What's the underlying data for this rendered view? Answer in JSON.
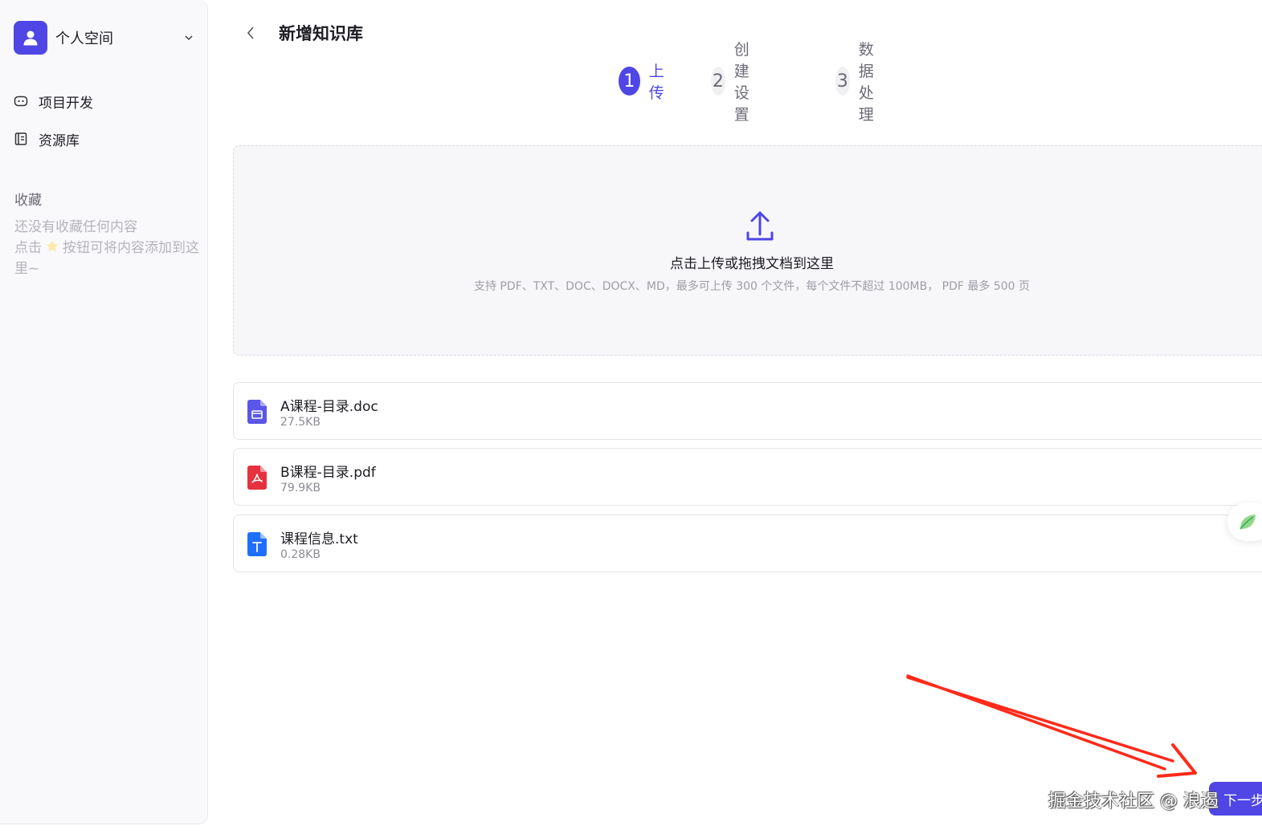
{
  "sidebar": {
    "workspace_name": "个人空间",
    "nav": [
      {
        "label": "项目开发",
        "icon": "bot-icon"
      },
      {
        "label": "资源库",
        "icon": "library-icon"
      }
    ],
    "favorites_title": "收藏",
    "favorites_empty_line1": "还没有收藏任何内容",
    "favorites_empty_line2_prefix": "点击",
    "favorites_empty_line2_suffix": "按钮可将内容添加到这里~"
  },
  "header": {
    "title": "新增知识库"
  },
  "steps": [
    {
      "num": "1",
      "label": "上传",
      "state": "active"
    },
    {
      "num": "2",
      "label": "创建设置",
      "state": "inactive"
    },
    {
      "num": "3",
      "label": "数据处理",
      "state": "inactive"
    }
  ],
  "upload": {
    "title": "点击上传或拖拽文档到这里",
    "hint": "支持 PDF、TXT、DOC、DOCX、MD，最多可上传 300 个文件，每个文件不超过 100MB， PDF 最多 500 页"
  },
  "files": [
    {
      "name": "A课程-目录.doc",
      "size": "27.5KB",
      "type": "doc"
    },
    {
      "name": "B课程-目录.pdf",
      "size": "79.9KB",
      "type": "pdf"
    },
    {
      "name": "课程信息.txt",
      "size": "0.28KB",
      "type": "txt"
    }
  ],
  "footer": {
    "next_label": "下一步",
    "watermark": "掘金技术社区 @ 浪遏"
  },
  "colors": {
    "accent": "#4f46e5",
    "pdf": "#e5323e",
    "txt": "#1f6fff",
    "annotation": "#ff2a1a"
  }
}
